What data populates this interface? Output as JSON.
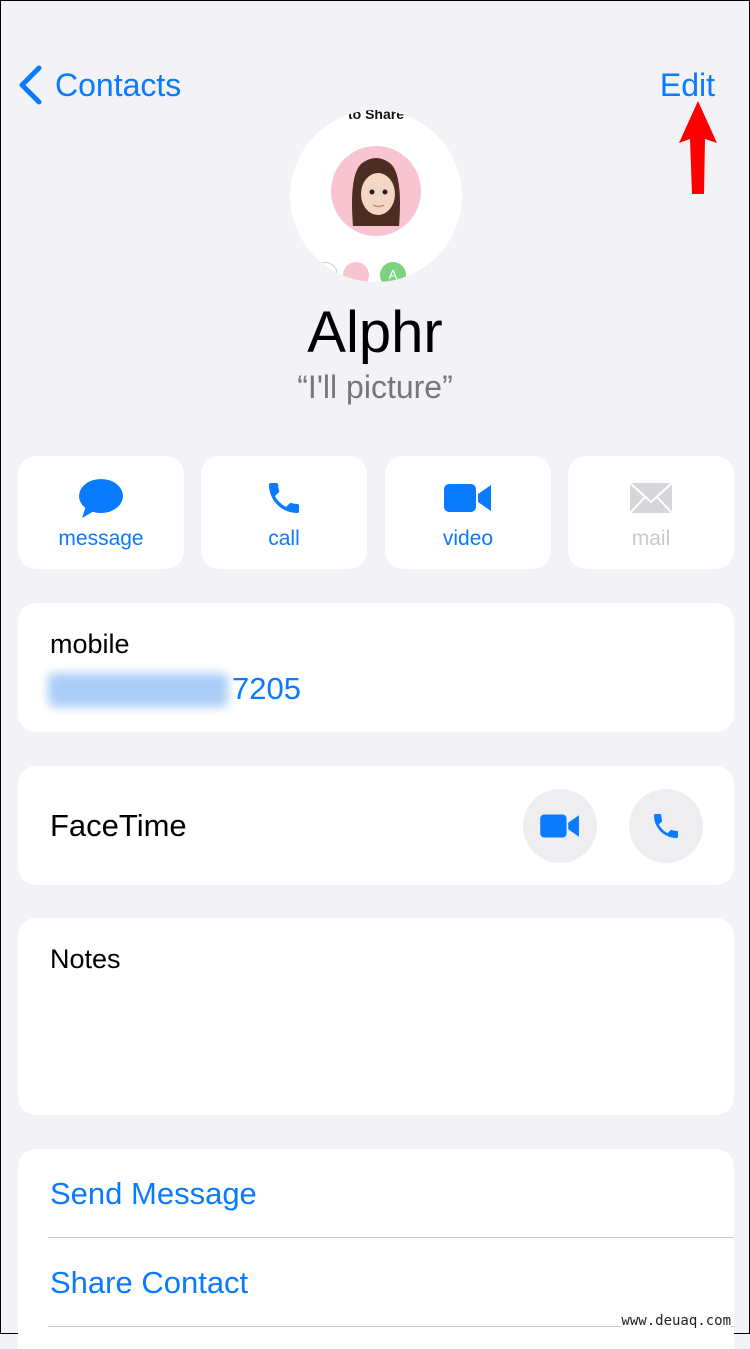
{
  "nav": {
    "back_label": "Contacts",
    "edit_label": "Edit"
  },
  "avatar": {
    "poster_caption": "to Share",
    "mini_initial": "A"
  },
  "contact": {
    "name": "Alphr",
    "nickname": "“I'll picture”"
  },
  "actions": [
    {
      "label": "message",
      "icon": "message-bubble-icon",
      "enabled": true
    },
    {
      "label": "call",
      "icon": "phone-icon",
      "enabled": true
    },
    {
      "label": "video",
      "icon": "video-camera-icon",
      "enabled": true
    },
    {
      "label": "mail",
      "icon": "envelope-icon",
      "enabled": false
    }
  ],
  "phone": {
    "label": "mobile",
    "number_visible": "7205",
    "blurred": true
  },
  "facetime": {
    "label": "FaceTime"
  },
  "notes": {
    "label": "Notes",
    "value": ""
  },
  "links": [
    {
      "label": "Send Message"
    },
    {
      "label": "Share Contact"
    }
  ],
  "watermark": "www.deuaq.com",
  "colors": {
    "accent": "#0a7aff",
    "background": "#f2f2f7",
    "annotation_arrow": "#ff0000"
  }
}
